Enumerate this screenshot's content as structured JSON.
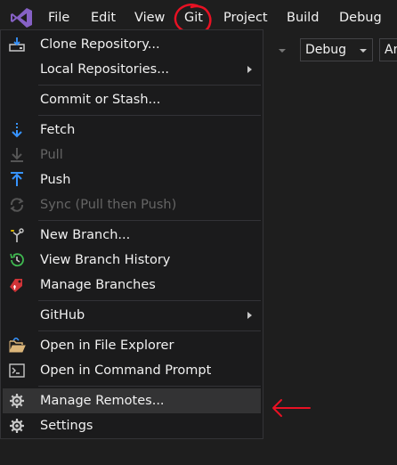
{
  "menubar": {
    "items": [
      "File",
      "Edit",
      "View",
      "Git",
      "Project",
      "Build",
      "Debug"
    ]
  },
  "toolbar": {
    "config_value": "Debug",
    "platform_value": "An"
  },
  "git_menu": {
    "clone": "Clone Repository...",
    "local_repos": "Local Repositories...",
    "commit": "Commit or Stash...",
    "fetch": "Fetch",
    "pull": "Pull",
    "push": "Push",
    "sync": "Sync (Pull then Push)",
    "new_branch": "New Branch...",
    "view_history": "View Branch History",
    "manage_branches": "Manage Branches",
    "github": "GitHub",
    "open_explorer": "Open in File Explorer",
    "open_cmd": "Open in Command Prompt",
    "manage_remotes": "Manage Remotes...",
    "settings": "Settings"
  },
  "colors": {
    "menu_bg": "#1b1b1c",
    "hover_bg": "#333334",
    "accent_blue": "#3794ff",
    "annotation_red": "#e81123"
  }
}
